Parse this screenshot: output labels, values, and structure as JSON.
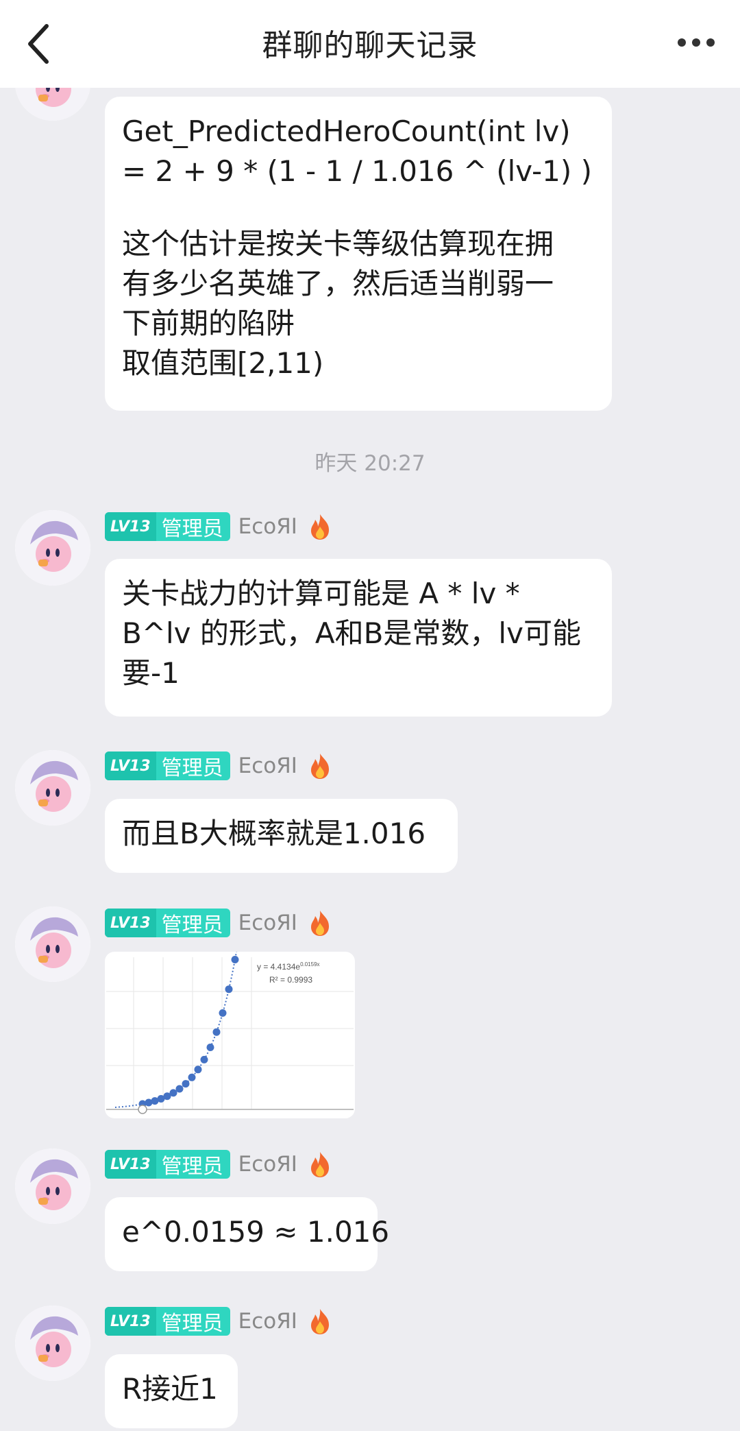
{
  "header": {
    "title": "群聊的聊天记录"
  },
  "user": {
    "level": "LV13",
    "role": "管理员",
    "name": "EcoЯI"
  },
  "timestamp": "昨天 20:27",
  "messages": {
    "m0": {
      "lines": [
        "Get_PredictedHeroCount(int lv)",
        "= 2 + 9 * (1 - 1 / 1.016 ^ (lv-1) )",
        "",
        "这个估计是按关卡等级估算现在拥",
        "有多少名英雄了，然后适当削弱一",
        "下前期的陷阱",
        "取值范围[2,11)"
      ]
    },
    "m1": {
      "lines": [
        "关卡战力的计算可能是 A * lv *",
        "B^lv 的形式，A和B是常数，lv可能",
        "要-1"
      ]
    },
    "m2": {
      "lines": [
        "而且B大概率就是1.016"
      ]
    },
    "m4": {
      "lines": [
        "e^0.0159 ≈ 1.016"
      ]
    },
    "m5": {
      "lines": [
        "R接近1"
      ]
    }
  },
  "chart_data": {
    "type": "scatter",
    "trendline": "exponential",
    "equation": "y = 4.4134e",
    "equation_exponent": "0.0159x",
    "r_squared": "R² = 0.9993",
    "series_color": "#4472c4",
    "gridlines": true
  },
  "colors": {
    "badge": "#2fd6c0",
    "badge_dark": "#1ec3ad",
    "background": "#ededf1"
  }
}
